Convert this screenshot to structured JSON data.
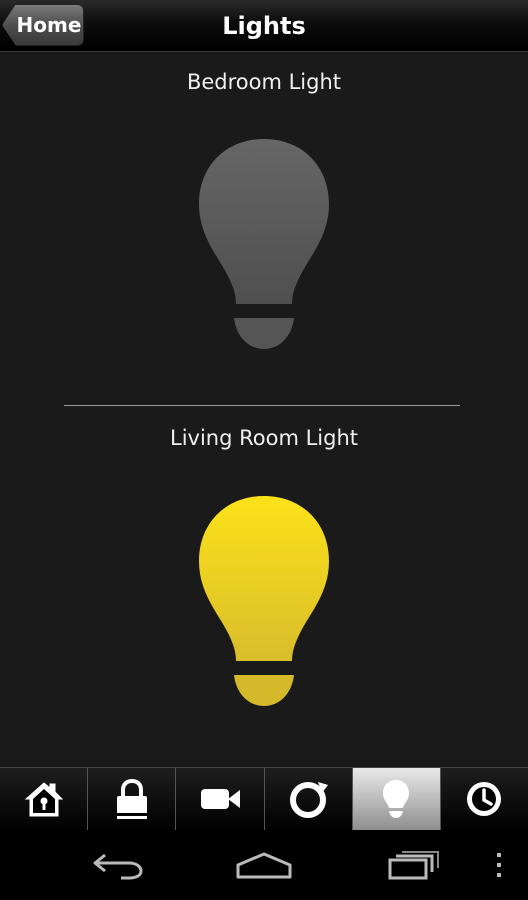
{
  "header": {
    "back_label": "Home",
    "title": "Lights"
  },
  "lights": [
    {
      "label": "Bedroom Light",
      "state": "off",
      "color": "#5a5a5a"
    },
    {
      "label": "Living Room Light",
      "state": "on",
      "color": "#f4d41a"
    }
  ],
  "tabs": [
    {
      "icon": "home-icon",
      "active": false
    },
    {
      "icon": "lock-icon",
      "active": false
    },
    {
      "icon": "camera-icon",
      "active": false
    },
    {
      "icon": "thermostat-icon",
      "active": false
    },
    {
      "icon": "lightbulb-icon",
      "active": true
    },
    {
      "icon": "clock-icon",
      "active": false
    }
  ],
  "navbar": {
    "icons": [
      "back-icon",
      "home-icon",
      "recent-apps-icon",
      "overflow-menu-icon"
    ]
  }
}
